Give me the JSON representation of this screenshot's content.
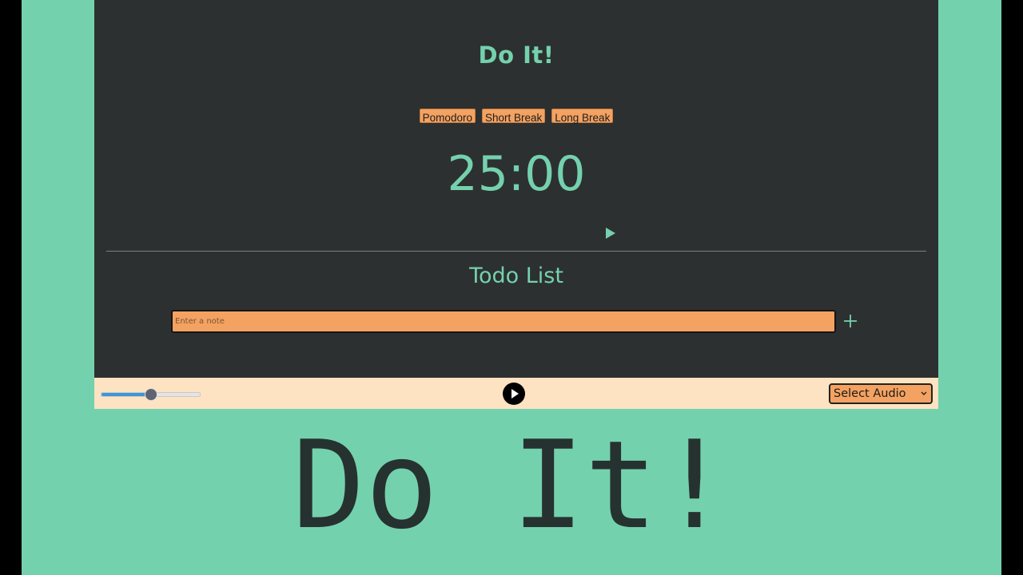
{
  "app": {
    "title": "Do It!",
    "modes": [
      "Pomodoro",
      "Short Break",
      "Long Break"
    ],
    "timer": "25:00",
    "todo_title": "Todo List",
    "note_placeholder": "Enter a note"
  },
  "audio_bar": {
    "volume_level": 0.5,
    "select_label": "Select Audio"
  },
  "overlay_title": "Do It!",
  "colors": {
    "accent": "#74d1ae",
    "panel": "#2d3030",
    "button": "#f4a261",
    "audio_bar": "#fde3c2"
  },
  "icons": {
    "timer_play": "play-icon",
    "add": "plus-icon",
    "audio_play": "play-circle-icon",
    "select_arrow": "chevron-down-icon"
  }
}
